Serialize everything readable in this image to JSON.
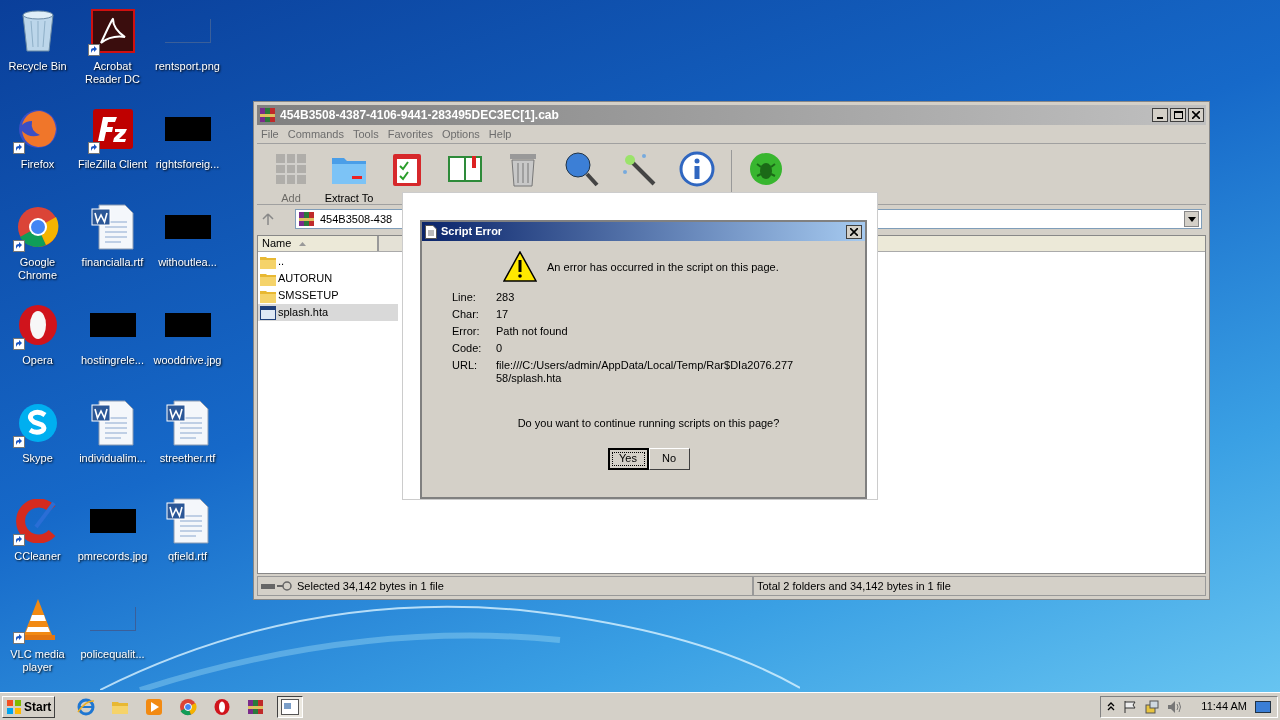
{
  "desktop": {
    "icons": [
      {
        "label": "Recycle Bin",
        "kind": "recycle",
        "shortcut": false
      },
      {
        "label": "Firefox",
        "kind": "firefox",
        "shortcut": true
      },
      {
        "label": "Google Chrome",
        "kind": "chrome",
        "shortcut": true
      },
      {
        "label": "Opera",
        "kind": "opera",
        "shortcut": true
      },
      {
        "label": "Skype",
        "kind": "skype",
        "shortcut": true
      },
      {
        "label": "CCleaner",
        "kind": "ccleaner",
        "shortcut": true
      },
      {
        "label": "VLC media player",
        "kind": "vlc",
        "shortcut": true
      },
      {
        "label": "Acrobat Reader DC",
        "kind": "acrobat",
        "shortcut": true
      },
      {
        "label": "FileZilla Client",
        "kind": "filezilla",
        "shortcut": true
      },
      {
        "label": "financialla.rtf",
        "kind": "word",
        "shortcut": false
      },
      {
        "label": "hostingrele...",
        "kind": "redacted",
        "shortcut": false
      },
      {
        "label": "individualim...",
        "kind": "word",
        "shortcut": false
      },
      {
        "label": "pmrecords.jpg",
        "kind": "redacted",
        "shortcut": false
      },
      {
        "label": "policequalit...",
        "kind": "blank",
        "shortcut": false
      },
      {
        "label": "rentsport.png",
        "kind": "blank",
        "shortcut": false
      },
      {
        "label": "rightsforeig...",
        "kind": "redacted",
        "shortcut": false
      },
      {
        "label": "withoutlea...",
        "kind": "redacted",
        "shortcut": false
      },
      {
        "label": "wooddrive.jpg",
        "kind": "redacted",
        "shortcut": false
      },
      {
        "label": "streether.rtf",
        "kind": "word",
        "shortcut": false
      },
      {
        "label": "qfield.rtf",
        "kind": "word",
        "shortcut": false
      }
    ]
  },
  "window": {
    "title": "454B3508-4387-4106-9441-283495DEC3EC[1].cab",
    "menu": [
      "File",
      "Commands",
      "Tools",
      "Favorites",
      "Options",
      "Help"
    ],
    "toolbar": [
      {
        "kind": "add",
        "label": "Add",
        "disabled": true
      },
      {
        "kind": "extract",
        "label": "Extract To",
        "disabled": false
      },
      {
        "kind": "test"
      },
      {
        "kind": "view"
      },
      {
        "kind": "delete"
      },
      {
        "kind": "find"
      },
      {
        "kind": "wizard"
      },
      {
        "kind": "info"
      },
      {
        "kind": "virus"
      }
    ],
    "address": "454B3508-438",
    "columns": [
      "Name"
    ],
    "files": [
      {
        "name": "..",
        "kind": "folder",
        "selected": false
      },
      {
        "name": "AUTORUN",
        "kind": "folder",
        "selected": false
      },
      {
        "name": "SMSSETUP",
        "kind": "folder",
        "selected": false
      },
      {
        "name": "splash.hta",
        "kind": "hta",
        "selected": true
      }
    ],
    "status": [
      "Selected 34,142 bytes in 1 file",
      "Total 2 folders and 34,142 bytes in 1 file"
    ]
  },
  "dialog": {
    "title": "Script Error",
    "message": "An error has occurred in the script on this page.",
    "fields": [
      {
        "label": "Line:",
        "value": "283"
      },
      {
        "label": "Char:",
        "value": "17"
      },
      {
        "label": "Error:",
        "value": "Path not found"
      },
      {
        "label": "Code:",
        "value": "0"
      },
      {
        "label": "URL:",
        "value": "file:///C:/Users/admin/AppData/Local/Temp/Rar$DIa2076.27758/splash.hta"
      }
    ],
    "question": "Do you want to continue running scripts on this page?",
    "buttons": [
      {
        "label": "Yes",
        "selected": true
      },
      {
        "label": "No",
        "selected": false
      }
    ]
  },
  "taskbar": {
    "start": "Start",
    "items": [
      {
        "kind": "ie",
        "selected": false
      },
      {
        "kind": "explorer",
        "selected": false
      },
      {
        "kind": "media",
        "selected": false
      },
      {
        "kind": "chrome",
        "selected": false
      },
      {
        "kind": "opera",
        "selected": false
      },
      {
        "kind": "winrar",
        "selected": false
      },
      {
        "kind": "hta",
        "selected": true
      }
    ],
    "clock": "11:44 AM"
  }
}
